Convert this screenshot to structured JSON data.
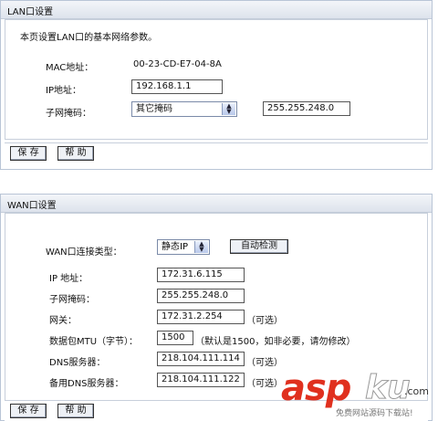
{
  "lan": {
    "title": "LAN口设置",
    "description": "本页设置LAN口的基本网络参数。",
    "mac_label": "MAC地址：",
    "mac_value": "00-23-CD-E7-04-8A",
    "ip_label": "IP地址：",
    "ip_value": "192.168.1.1",
    "mask_label": "子网掩码：",
    "mask_select": "其它掩码",
    "mask_value": "255.255.248.0",
    "save": "保 存",
    "help": "帮 助"
  },
  "wan": {
    "title": "WAN口设置",
    "type_label": "WAN口连接类型：",
    "type_select": "静态IP",
    "auto_detect": "自动检测",
    "ip_label": "IP 地址：",
    "ip_value": "172.31.6.115",
    "mask_label": "子网掩码：",
    "mask_value": "255.255.248.0",
    "gateway_label": "网关：",
    "gateway_value": "172.31.2.254",
    "gateway_note": "（可选）",
    "mtu_label": "数据包MTU（字节）：",
    "mtu_value": "1500",
    "mtu_note": "（默认是1500，如非必要，请勿修改）",
    "dns_label": "DNS服务器：",
    "dns_value": "218.104.111.114",
    "dns_note": "（可选）",
    "dns2_label": "备用DNS服务器：",
    "dns2_value": "218.104.111.122",
    "dns2_note": "（可选）",
    "save": "保 存",
    "help": "帮 助"
  },
  "watermark": {
    "asp": "asp",
    "ku": "ku",
    "com": ".com",
    "sub": "免费网站源码下载站!"
  }
}
